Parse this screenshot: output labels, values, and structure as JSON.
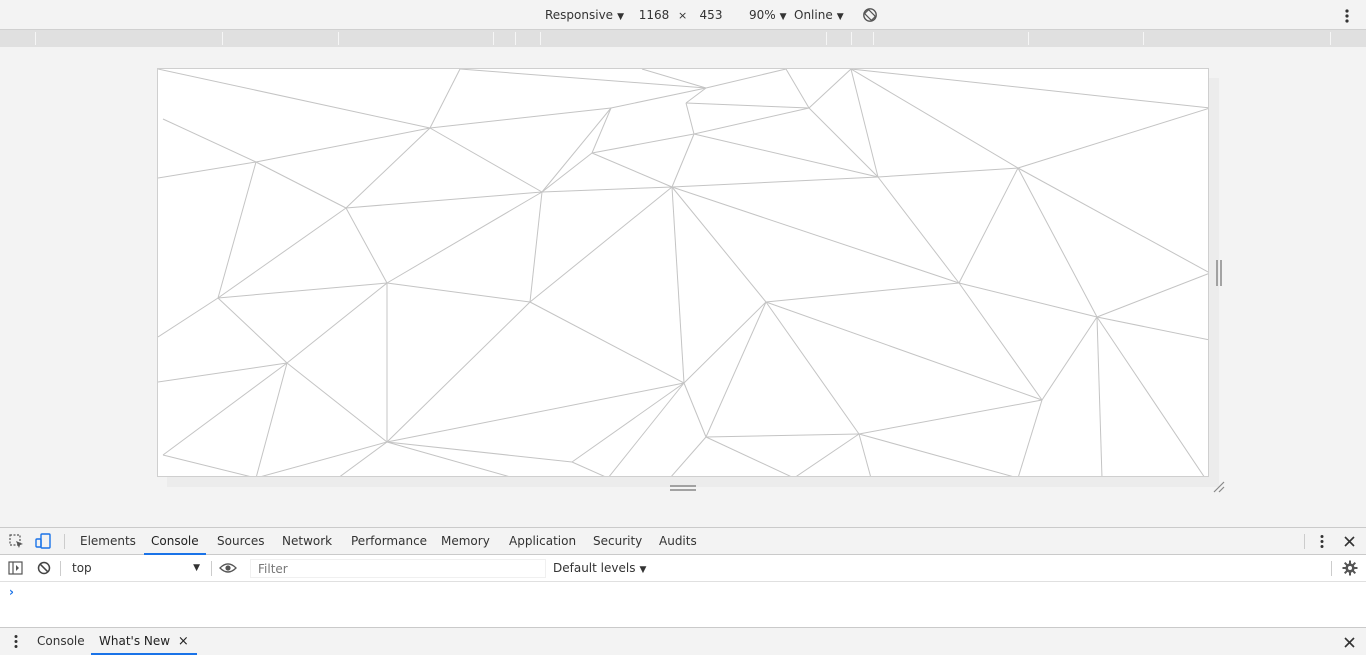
{
  "device_toolbar": {
    "device": "Responsive",
    "width": "1168",
    "times": "×",
    "height": "453",
    "zoom": "90%",
    "throttling": "Online"
  },
  "devtools": {
    "tabs": [
      {
        "label": "Elements"
      },
      {
        "label": "Console",
        "active": true
      },
      {
        "label": "Sources"
      },
      {
        "label": "Network"
      },
      {
        "label": "Performance"
      },
      {
        "label": "Memory"
      },
      {
        "label": "Application"
      },
      {
        "label": "Security"
      },
      {
        "label": "Audits"
      }
    ],
    "console_toolbar": {
      "context": "top",
      "filter_placeholder": "Filter",
      "levels": "Default levels"
    },
    "prompt": "›",
    "drawer": {
      "tabs": [
        {
          "label": "Console"
        },
        {
          "label": "What's New",
          "active": true
        }
      ],
      "close_glyph": "×"
    }
  },
  "colors": {
    "accent": "#1a73e8",
    "mesh_line": "#c4c4c4"
  }
}
